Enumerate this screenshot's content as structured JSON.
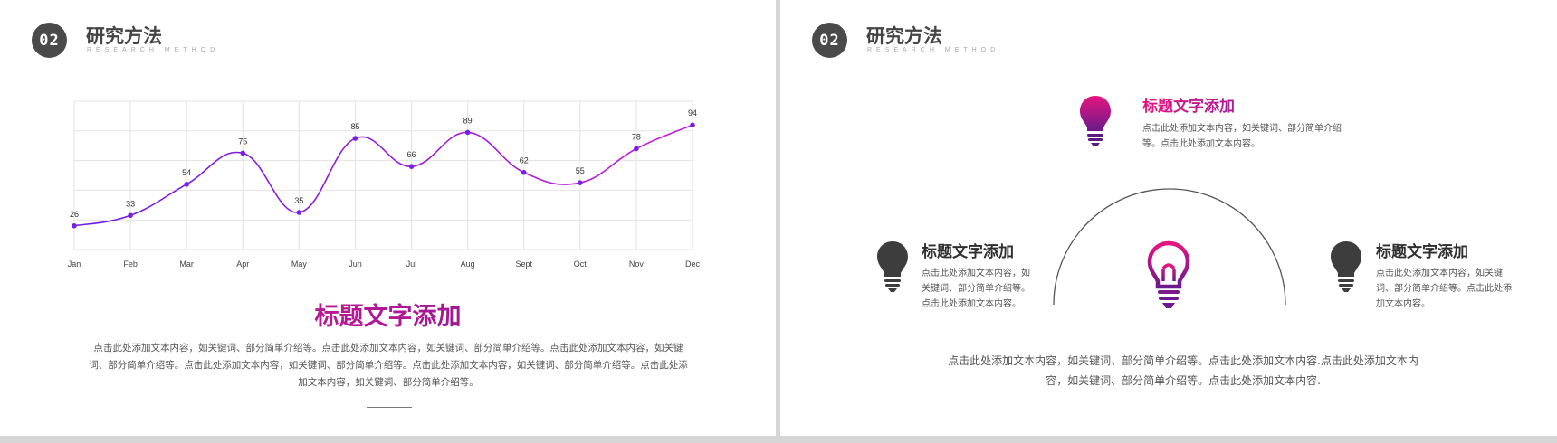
{
  "left_slide": {
    "badge": "02",
    "title": "研究方法",
    "subtitle": "RESEARCH METHOD",
    "main_title": "标题文字添加",
    "main_body": "点击此处添加文本内容，如关键词、部分简单介绍等。点击此处添加文本内容，如关键词、部分简单介绍等。点击此处添加文本内容，如关键词、部分简单介绍等。点击此处添加文本内容，如关键词、部分简单介绍等。点击此处添加文本内容，如关键词、部分简单介绍等。点击此处添加文本内容，如关键词、部分简单介绍等。"
  },
  "chart_data": {
    "type": "line",
    "categories": [
      "Jan",
      "Feb",
      "Mar",
      "Apr",
      "May",
      "Jun",
      "Jul",
      "Aug",
      "Sept",
      "Oct",
      "Nov",
      "Dec"
    ],
    "series": [
      {
        "values": [
          26,
          33,
          54,
          75,
          35,
          85,
          66,
          89,
          62,
          55,
          78,
          94
        ]
      }
    ],
    "ylim": [
      10,
      110
    ],
    "grid": true,
    "line_gradient": [
      "#6a1ee0",
      "#c21fd4"
    ],
    "point_color": "#7a1fe6"
  },
  "right_slide": {
    "badge": "02",
    "title": "研究方法",
    "subtitle": "RESEARCH METHOD",
    "top_item": {
      "title": "标题文字添加",
      "body": "点击此处添加文本内容，如关键词、部分简单介绍等。点击此处添加文本内容。",
      "icon": "lightbulb-icon"
    },
    "left_item": {
      "title": "标题文字添加",
      "body": "点击此处添加文本内容，如关键词、部分简单介绍等。点击此处添加文本内容。",
      "icon": "lightbulb-icon"
    },
    "right_item": {
      "title": "标题文字添加",
      "body": "点击此处添加文本内容，如关键词、部分简单介绍等。点击此处添加文本内容。",
      "icon": "lightbulb-icon"
    },
    "center_icon": "lightbulb-outline-icon",
    "bottom_body": "点击此处添加文本内容，如关键词、部分简单介绍等。点击此处添加文本内容.点击此处添加文本内容，如关键词、部分简单介绍等。点击此处添加文本内容.",
    "colors": {
      "accent_start": "#e6157f",
      "accent_end": "#5a1a8a",
      "dark": "#444444"
    }
  }
}
